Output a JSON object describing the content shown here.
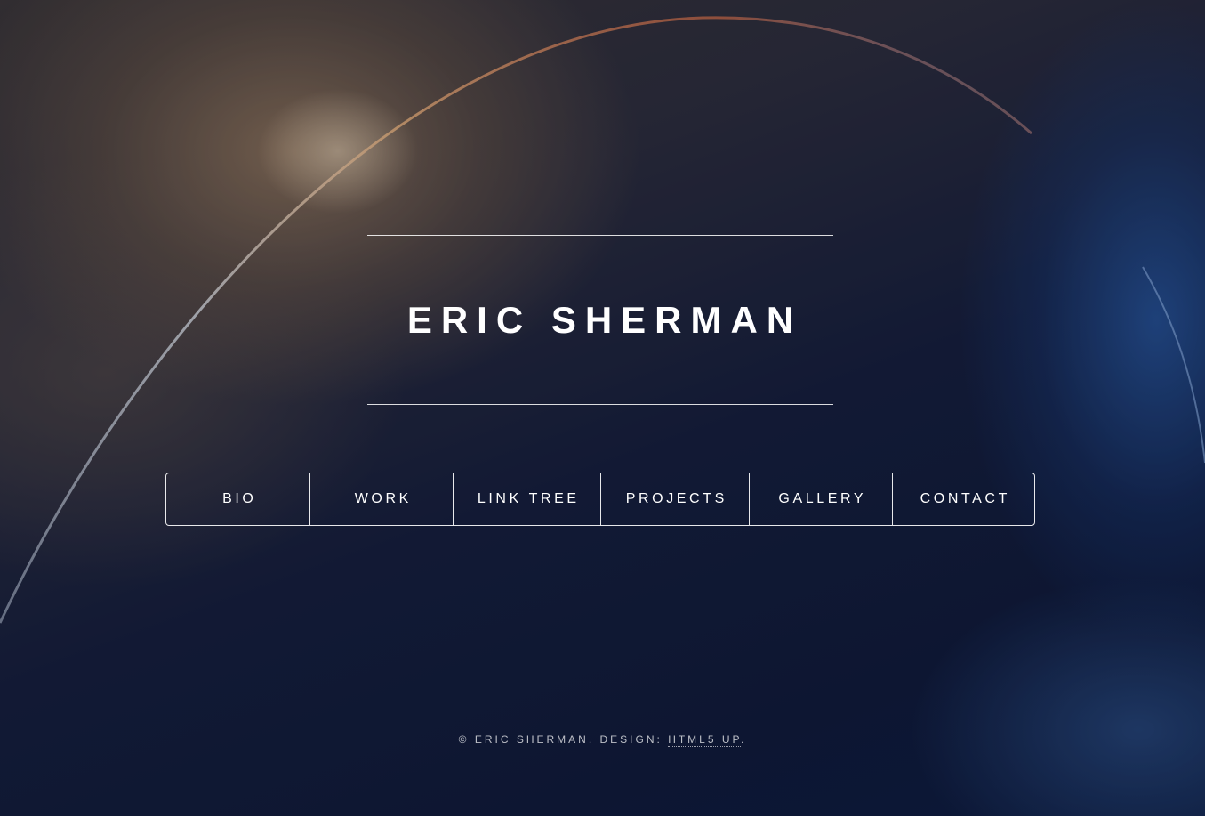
{
  "site": {
    "title": "ERIC SHERMAN"
  },
  "nav": {
    "items": [
      {
        "label": "BIO"
      },
      {
        "label": "WORK"
      },
      {
        "label": "LINK TREE"
      },
      {
        "label": "PROJECTS"
      },
      {
        "label": "GALLERY"
      },
      {
        "label": "CONTACT"
      }
    ]
  },
  "footer": {
    "copyright": "© ERIC SHERMAN. DESIGN: ",
    "design_link": "HTML5 UP",
    "period": "."
  },
  "colors": {
    "text": "#ffffff",
    "background_dark": "#0e1838",
    "background_warm": "#96785c",
    "background_blue": "#285caa"
  }
}
